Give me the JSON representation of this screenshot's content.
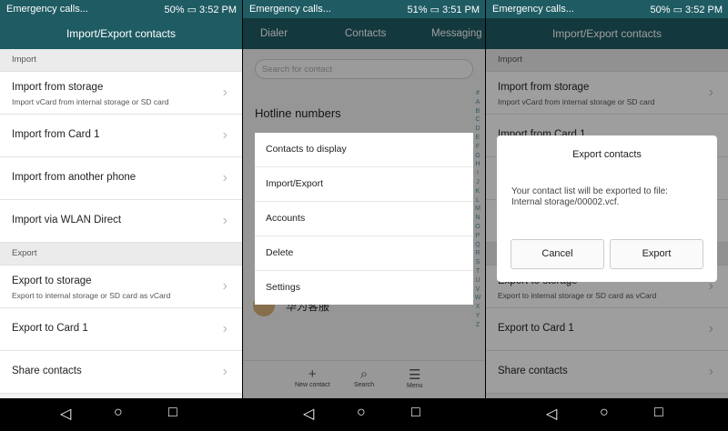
{
  "status": [
    {
      "left": "Emergency calls...",
      "right": "50% ▭ 3:52 PM"
    },
    {
      "left": "Emergency calls...",
      "right": "51% ▭ 3:51 PM"
    },
    {
      "left": "Emergency calls...",
      "right": "50% ▭ 3:52 PM"
    }
  ],
  "screen1": {
    "title": "Import/Export contacts",
    "import_header": "Import",
    "export_header": "Export",
    "import_items": [
      {
        "title": "Import from storage",
        "subtitle": "Import vCard from internal storage or SD card"
      },
      {
        "title": "Import from Card 1"
      },
      {
        "title": "Import from another phone"
      },
      {
        "title": "Import via WLAN Direct"
      }
    ],
    "export_items": [
      {
        "title": "Export to storage",
        "subtitle": "Export to internal storage or SD card as vCard"
      },
      {
        "title": "Export to Card 1"
      },
      {
        "title": "Share contacts"
      }
    ]
  },
  "screen2": {
    "tabs": [
      "Dialer",
      "Contacts",
      "Messaging"
    ],
    "search_placeholder": "Search for contact",
    "hotline": "Hotline numbers",
    "contact": "华为客服",
    "alpha": [
      "#",
      "A",
      "B",
      "C",
      "D",
      "E",
      "F",
      "G",
      "H",
      "I",
      "J",
      "K",
      "L",
      "M",
      "N",
      "O",
      "P",
      "Q",
      "R",
      "S",
      "T",
      "U",
      "V",
      "W",
      "X",
      "Y",
      "Z"
    ],
    "menu": [
      "Contacts to display",
      "Import/Export",
      "Accounts",
      "Delete",
      "Settings"
    ],
    "bottom": [
      {
        "icon": "+",
        "label": "New contact"
      },
      {
        "icon": "⌕",
        "label": "Search"
      },
      {
        "icon": "☰",
        "label": "Menu"
      }
    ]
  },
  "screen3": {
    "title": "Import/Export contacts",
    "dialog": {
      "title": "Export contacts",
      "message_line1": "Your contact list will be exported to file:",
      "message_line2": "Internal storage/00002.vcf.",
      "cancel": "Cancel",
      "export": "Export"
    }
  }
}
